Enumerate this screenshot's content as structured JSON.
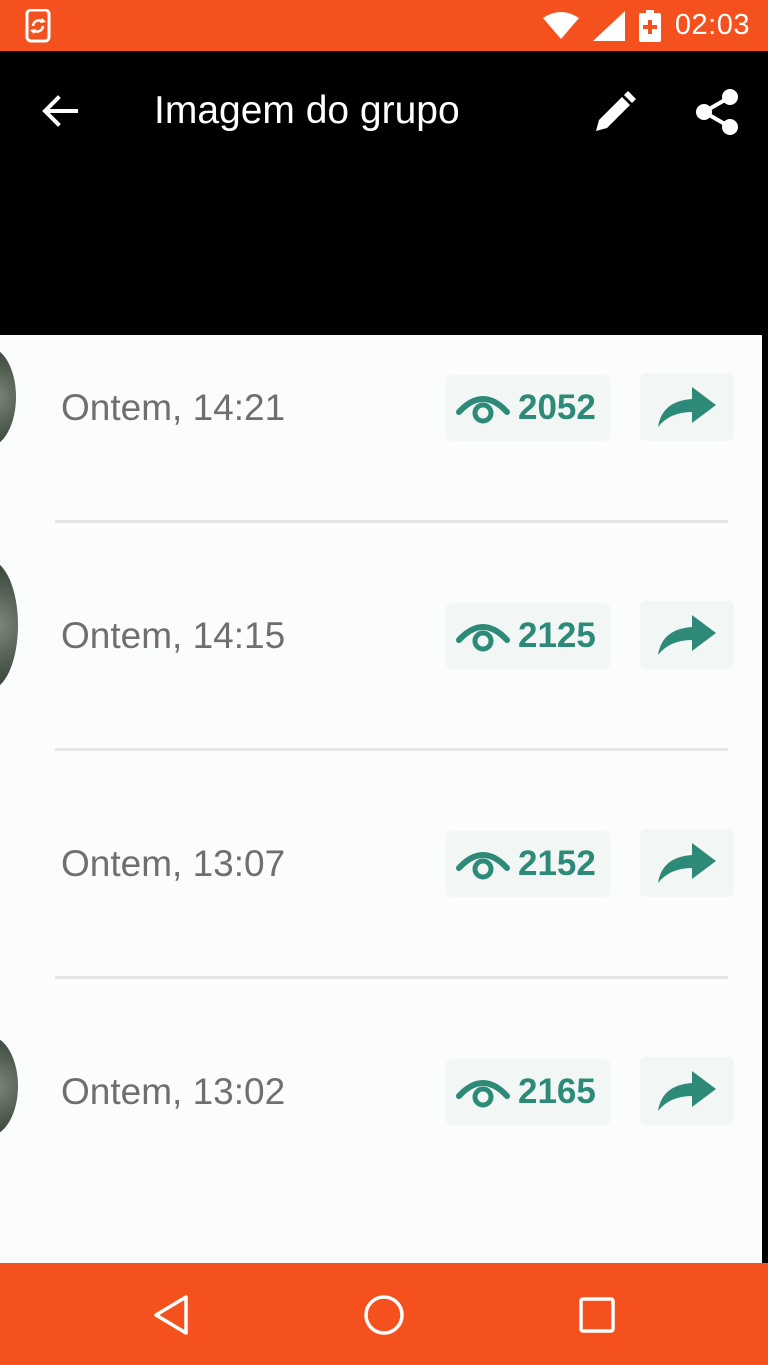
{
  "status_bar": {
    "time": "02:03",
    "icons": [
      "sync-phone-icon",
      "wifi-icon",
      "signal-icon",
      "battery-charging-icon"
    ],
    "background": "#f4511e"
  },
  "app_bar": {
    "title": "Imagem do grupo",
    "icons": [
      "back-arrow-icon",
      "edit-pencil-icon",
      "share-icon"
    ]
  },
  "image": {
    "rows": [
      {
        "time": "Ontem, 14:21",
        "views": "2052"
      },
      {
        "time": "Ontem, 14:15",
        "views": "2125"
      },
      {
        "time": "Ontem, 13:07",
        "views": "2152"
      },
      {
        "time": "Ontem, 13:02",
        "views": "2165"
      }
    ],
    "accent": "#2e8a78"
  },
  "nav_bar": {
    "buttons": [
      "back-triangle-icon",
      "home-circle-icon",
      "recents-square-icon"
    ],
    "background": "#f4511e"
  }
}
